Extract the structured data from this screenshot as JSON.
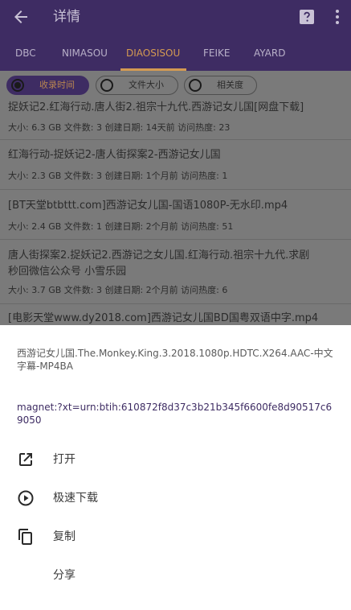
{
  "app_bar": {
    "title": "详情",
    "back_icon": "arrow-back-icon",
    "help_icon": "help-icon",
    "more_icon": "more-vert-icon"
  },
  "tabs": [
    {
      "label": "DBC"
    },
    {
      "label": "NIMASOU"
    },
    {
      "label": "DIAOSISOU",
      "active": true
    },
    {
      "label": "FEIKE"
    },
    {
      "label": "AYARD"
    }
  ],
  "sort_options": [
    {
      "label": "收录时间",
      "selected": true
    },
    {
      "label": "文件大小",
      "selected": false
    },
    {
      "label": "相关度",
      "selected": false
    }
  ],
  "results": [
    {
      "name": "捉妖记2.红海行动.唐人街2.祖宗十九代.西游记女儿国[网盘下载]",
      "meta": "大小: 6.3 GB 文件数: 3 创建日期: 14天前 访问热度: 23"
    },
    {
      "name": "红海行动-捉妖记2-唐人街探案2-西游记女儿国",
      "meta": "大小: 2.3 GB 文件数: 3 创建日期: 1个月前 访问热度: 1"
    },
    {
      "name": "[BT天堂btbttt.com]西游记女儿国-国语1080P-无水印.mp4",
      "meta": "大小: 2.4 GB 文件数: 1 创建日期: 2个月前 访问热度: 51"
    },
    {
      "name_line1": "唐人街探案2.捉妖记2.西游记之女儿国.红海行动.祖宗十九代.求剧",
      "name_line2": "秒回微信公众号 小雪乐园",
      "meta": "大小: 3.7 GB 文件数: 3 创建日期: 2个月前 访问热度: 6"
    },
    {
      "name": "[电影天堂www.dy2018.com]西游记女儿国BD国粤双语中字.mp4"
    }
  ],
  "sheet": {
    "filename": "西游记女儿国.The.Monkey.King.3.2018.1080p.HDTC.X264.AAC-中文字幕-MP4BA",
    "magnet": "magnet:?xt=urn:btih:610872f8d37c3b21b345f6600fe8d90517c69050",
    "actions": [
      {
        "label": "打开",
        "icon": "open-in-new-icon"
      },
      {
        "label": "极速下载",
        "icon": "play-circle-icon"
      },
      {
        "label": "复制",
        "icon": "copy-icon"
      },
      {
        "label": "分享",
        "icon": ""
      }
    ]
  },
  "colors": {
    "app_bar": "#3e2c63",
    "accent": "#d49a52",
    "scrim_bg": "#7a7a7a",
    "magnet_text": "#3e2c63"
  }
}
